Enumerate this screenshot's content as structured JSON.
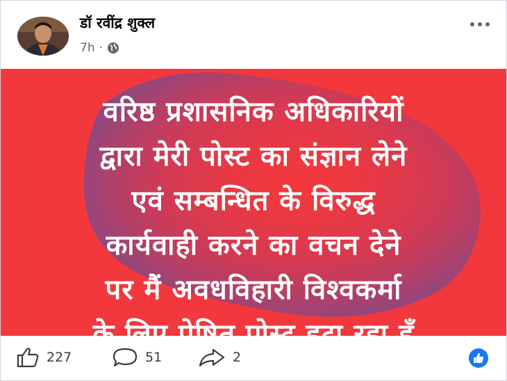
{
  "post": {
    "author": "डॉ रवींद्र शुक्ल",
    "time": "7h",
    "separator": "·",
    "privacy_icon": "globe-icon",
    "more_icon": "more-options-icon"
  },
  "image_text": {
    "lines": [
      "वरिष्ठ प्रशासनिक अधिकारियों",
      "द्वारा मेरी पोस्ट का संज्ञान लेने",
      "एवं सम्बन्धित के विरुद्ध",
      "कार्यवाही करने का वचन देने",
      "पर मैं अवधविहारी विश्वकर्मा",
      "के लिए प्रेषित पोस्ट हटा रहा हूँ"
    ]
  },
  "actions": {
    "likes": "227",
    "comments": "51",
    "shares": "2"
  },
  "colors": {
    "banner_red": "#f2383d",
    "blob_purple": "#7a4a8c",
    "facebook_blue": "#1877f2"
  }
}
